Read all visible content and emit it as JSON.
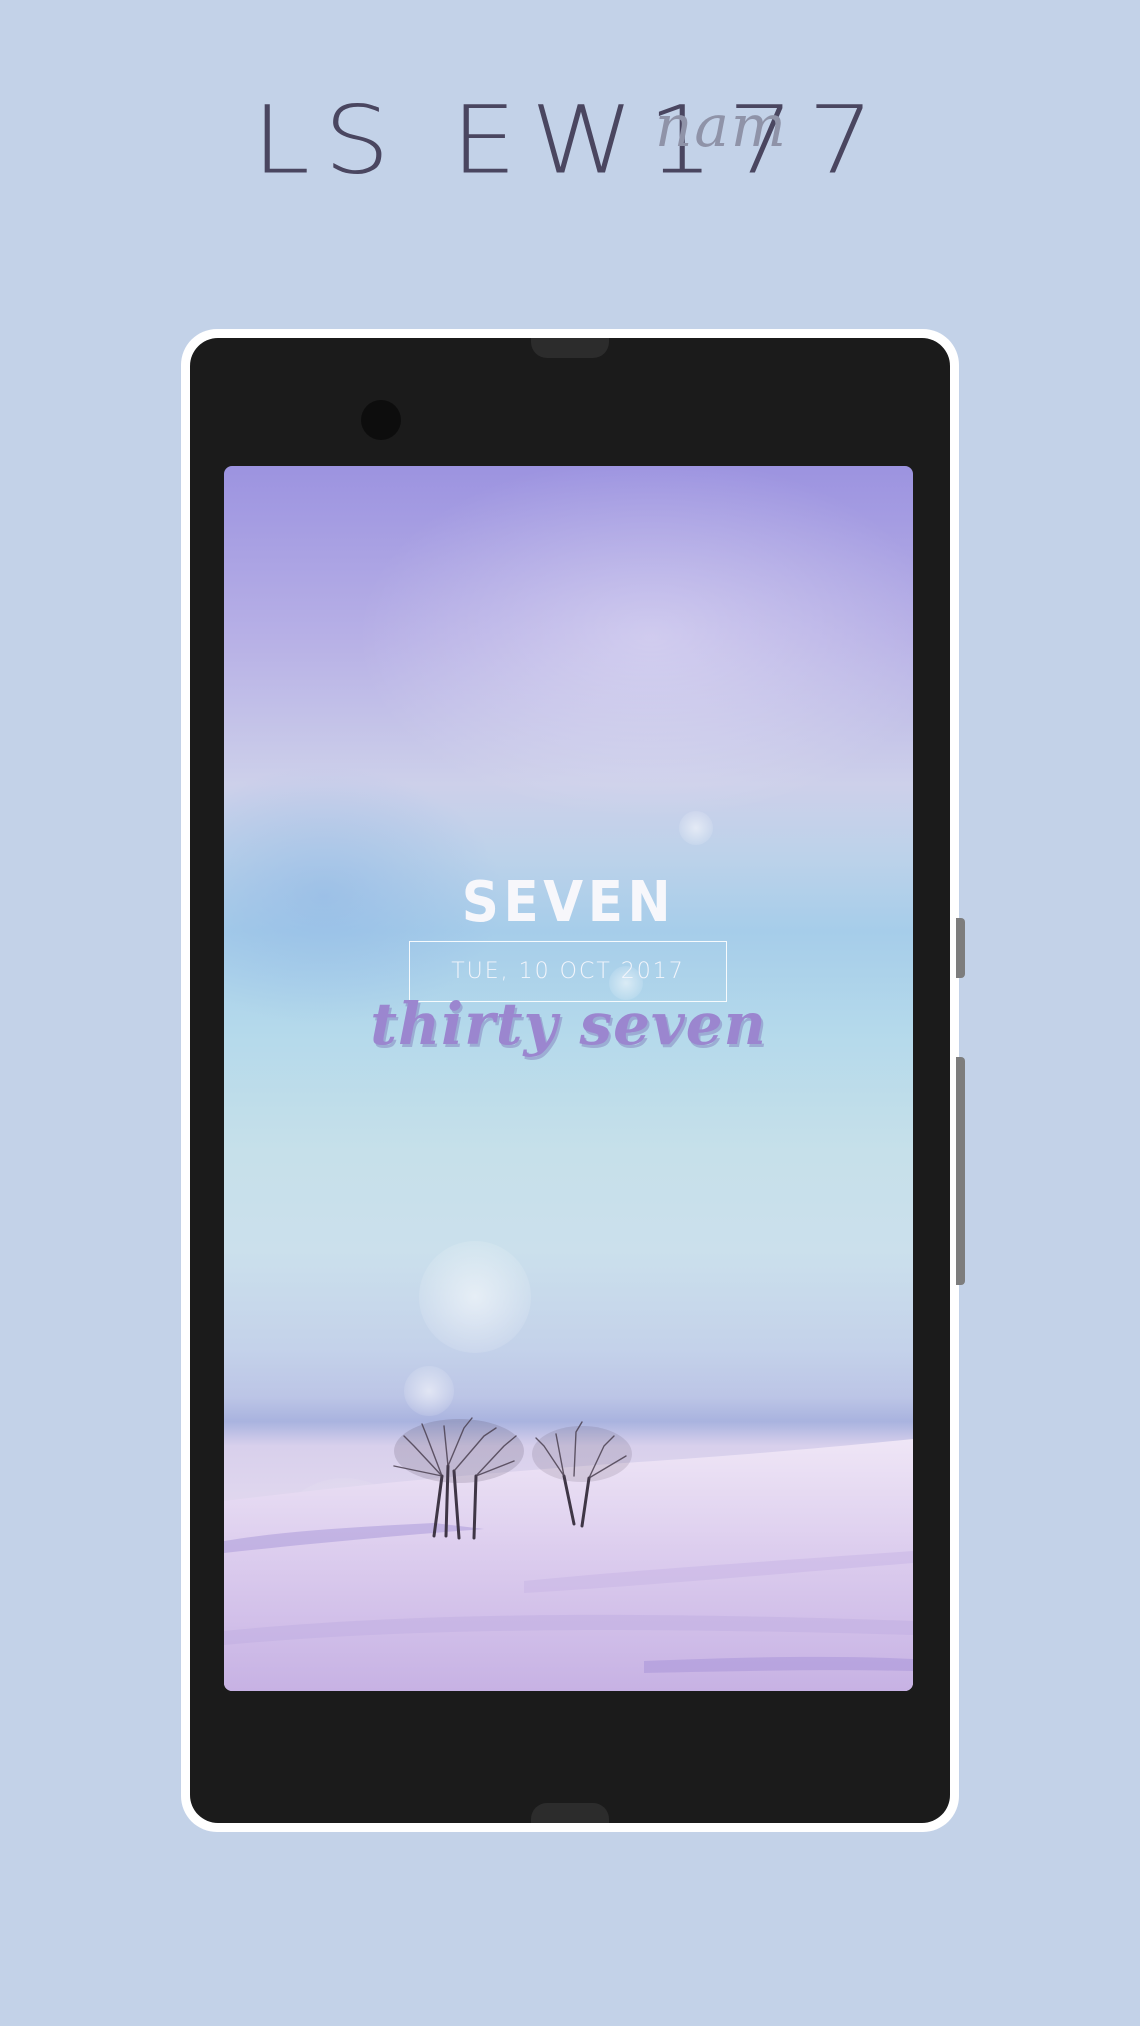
{
  "header": {
    "logo_main": "LS EW177",
    "logo_sub": "nam"
  },
  "lockscreen": {
    "hour_word": "SEVEN",
    "date": "TUE, 10 OCT 2017",
    "minute_words": "thirty seven"
  },
  "colors": {
    "background": "#c3d2e8",
    "phone_body": "#1b1b1b",
    "phone_bezel": "#ffffff",
    "minute_text": "#9b86cf"
  }
}
